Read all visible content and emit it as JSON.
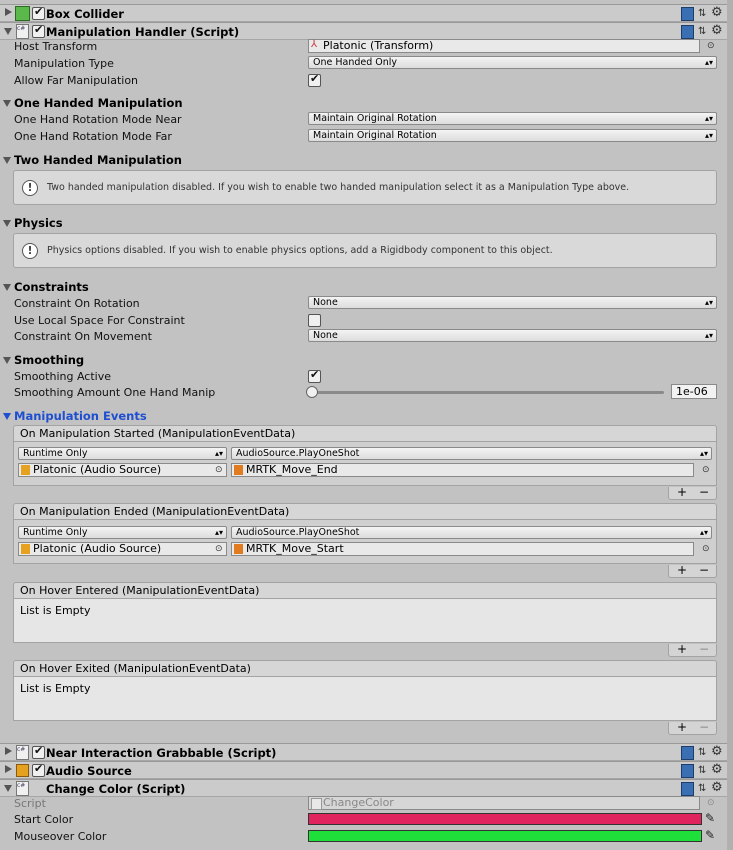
{
  "box_collider": {
    "title": "Box Collider"
  },
  "manip_handler": {
    "title": "Manipulation Handler (Script)",
    "host_transform_label": "Host Transform",
    "host_transform_value": "Platonic (Transform)",
    "manipulation_type_label": "Manipulation Type",
    "manipulation_type_value": "One Handed Only",
    "allow_far_label": "Allow Far Manipulation"
  },
  "one_handed": {
    "section": "One Handed Manipulation",
    "near_label": "One Hand Rotation Mode Near",
    "near_value": "Maintain Original Rotation",
    "far_label": "One Hand Rotation Mode Far",
    "far_value": "Maintain Original Rotation"
  },
  "two_handed": {
    "section": "Two Handed Manipulation",
    "help": "Two handed manipulation disabled. If you wish to enable two handed manipulation select it as a Manipulation Type above."
  },
  "physics": {
    "section": "Physics",
    "help": "Physics options disabled. If you wish to enable physics options, add a Rigidbody component to this object."
  },
  "constraints": {
    "section": "Constraints",
    "rotation_label": "Constraint On Rotation",
    "rotation_value": "None",
    "local_space_label": "Use Local Space For Constraint",
    "movement_label": "Constraint On Movement",
    "movement_value": "None"
  },
  "smoothing": {
    "section": "Smoothing",
    "active_label": "Smoothing Active",
    "amount_label": "Smoothing Amount One Hand Manip",
    "amount_value": "1e-06",
    "amount_fraction": 0.0
  },
  "events": {
    "section": "Manipulation Events",
    "started": {
      "title": "On Manipulation Started (ManipulationEventData)",
      "mode": "Runtime Only",
      "function": "AudioSource.PlayOneShot",
      "target": "Platonic (Audio Source)",
      "arg": "MRTK_Move_End"
    },
    "ended": {
      "title": "On Manipulation Ended (ManipulationEventData)",
      "mode": "Runtime Only",
      "function": "AudioSource.PlayOneShot",
      "target": "Platonic (Audio Source)",
      "arg": "MRTK_Move_Start"
    },
    "hover_entered": {
      "title": "On Hover Entered (ManipulationEventData)",
      "empty": "List is Empty"
    },
    "hover_exited": {
      "title": "On Hover Exited (ManipulationEventData)",
      "empty": "List is Empty"
    }
  },
  "near_interaction": {
    "title": "Near Interaction Grabbable (Script)"
  },
  "audio_source": {
    "title": "Audio Source"
  },
  "change_color": {
    "title": "Change Color (Script)",
    "script_label": "Script",
    "script_value": "ChangeColor",
    "start_label": "Start Color",
    "start_color": "#e0245e",
    "mouseover_label": "Mouseover Color",
    "mouseover_color": "#1fe03a"
  },
  "colors": {
    "events_section": "#1f4fd1",
    "accent_check": "#111111"
  }
}
